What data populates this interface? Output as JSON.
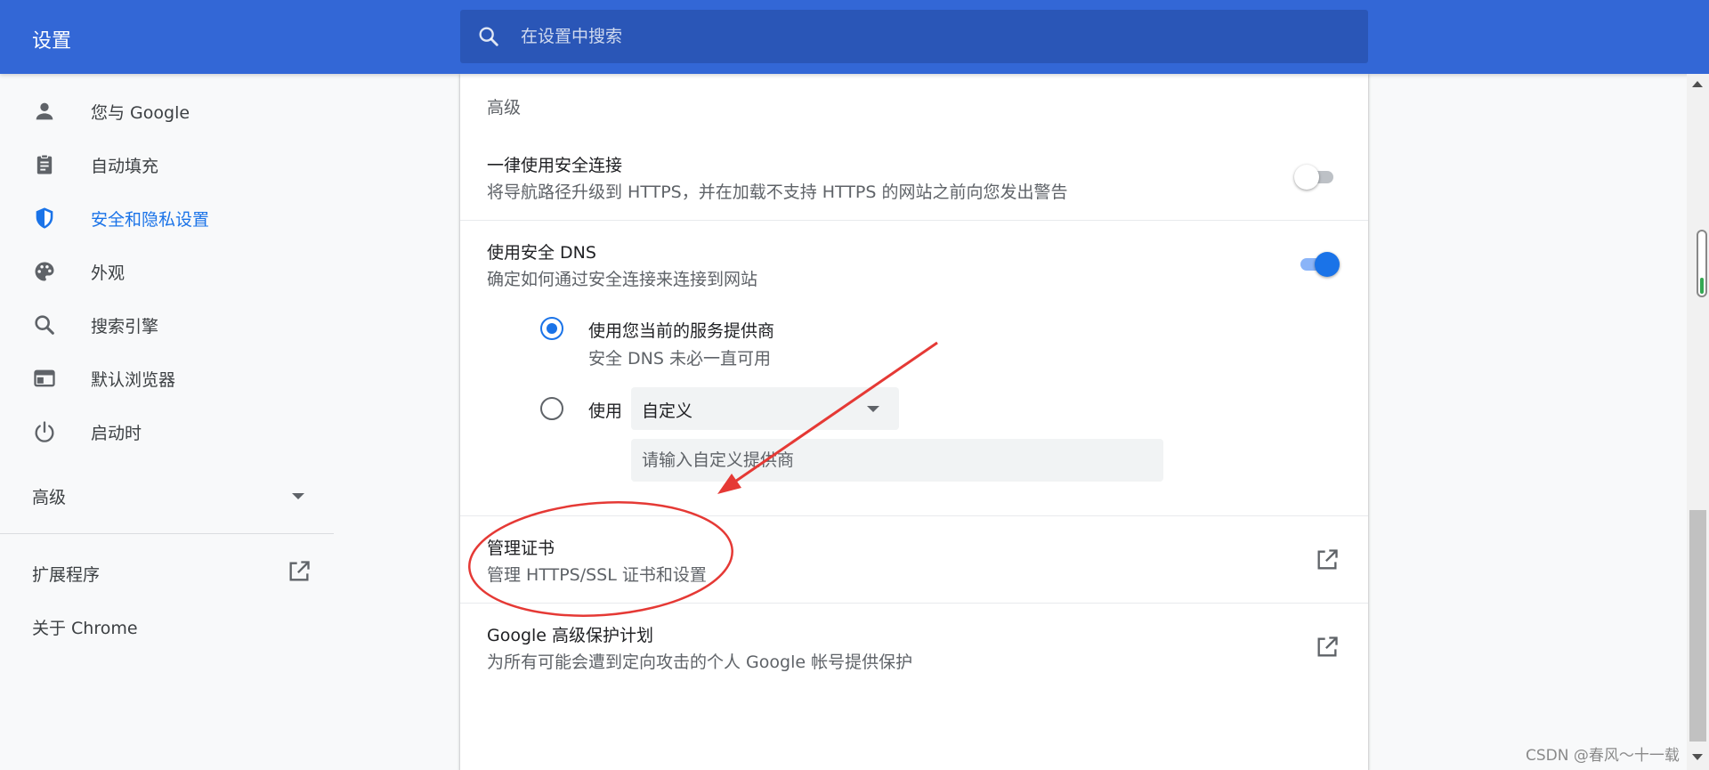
{
  "header": {
    "app_title": "设置",
    "search_placeholder": "在设置中搜索"
  },
  "sidebar": {
    "items": [
      {
        "label": "您与 Google",
        "icon": "person-icon",
        "active": false
      },
      {
        "label": "自动填充",
        "icon": "clipboard-icon",
        "active": false
      },
      {
        "label": "安全和隐私设置",
        "icon": "shield-icon",
        "active": true
      },
      {
        "label": "外观",
        "icon": "palette-icon",
        "active": false
      },
      {
        "label": "搜索引擎",
        "icon": "search-icon",
        "active": false
      },
      {
        "label": "默认浏览器",
        "icon": "browser-window-icon",
        "active": false
      },
      {
        "label": "启动时",
        "icon": "power-icon",
        "active": false
      }
    ],
    "advanced_label": "高级",
    "extensions_label": "扩展程序",
    "about_label": "关于 Chrome"
  },
  "content": {
    "section_header": "高级",
    "https": {
      "title": "一律使用安全连接",
      "subtitle": "将导航路径升级到 HTTPS，并在加载不支持 HTTPS 的网站之前向您发出警告",
      "enabled": false
    },
    "dns": {
      "title": "使用安全 DNS",
      "subtitle": "确定如何通过安全连接来连接到网站",
      "enabled": true,
      "option_current_label": "使用您当前的服务提供商",
      "option_current_sub": "安全 DNS 未必一直可用",
      "option_custom_label": "使用",
      "custom_select_value": "自定义",
      "custom_input_placeholder": "请输入自定义提供商"
    },
    "certificates": {
      "title": "管理证书",
      "subtitle": "管理 HTTPS/SSL 证书和设置"
    },
    "advanced_protection": {
      "title": "Google 高级保护计划",
      "subtitle": "为所有可能会遭到定向攻击的个人 Google 帐号提供保护"
    }
  },
  "colors": {
    "header_bg": "#3367d6",
    "accent": "#1a73e8",
    "annotation": "#e53935"
  },
  "watermark": "CSDN @春风～十一载"
}
